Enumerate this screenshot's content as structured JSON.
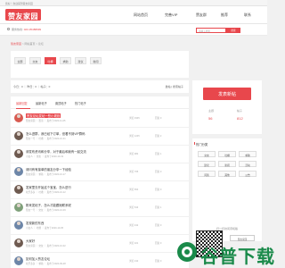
{
  "topbar": {
    "text": "您好！欢迎来到赞友家园"
  },
  "header": {
    "logo": "赞友家园",
    "nav": [
      "网站首页",
      "完善VIP",
      "赞友群",
      "推荐",
      "联系"
    ]
  },
  "location": {
    "label": "服务热线:",
    "phone": "023-35488999"
  },
  "search": {
    "placeholder": "请输入搜索",
    "button": "搜索"
  },
  "breadcrumb": {
    "home": "赞友家园",
    "items": [
      "网站首页",
      "论坛"
    ]
  },
  "categories": [
    {
      "label": "全部",
      "active": false
    },
    {
      "label": "交友",
      "active": false
    },
    {
      "label": "吐槽",
      "active": true
    },
    {
      "label": "求助",
      "active": false
    },
    {
      "label": "建议",
      "active": false
    },
    {
      "label": "新闻",
      "active": false
    }
  ],
  "stats": {
    "left": "今日：0 ｜ 昨日：0 ｜ 帖子：0",
    "right": "发帖 | 搜索帖子"
  },
  "tabs": [
    {
      "label": "最新回复",
      "active": true
    },
    {
      "label": "最新帖子",
      "active": false
    },
    {
      "label": "置顶帖子",
      "active": false
    },
    {
      "label": "热门帖子",
      "active": false
    }
  ],
  "posts": [
    {
      "title": "赞友论坛发帖一些小规则",
      "meta": "赞友家园 ｜ 置顶 ｜ 发布于2020-11-05",
      "views": "浏览 3345",
      "replies": "回复 0",
      "avatar": "red",
      "highlight": true
    },
    {
      "title": "怎么进群，我已经下订单，但看不到VIP群码",
      "meta": "赞友一号 ｜ 吐槽 ｜ 发布于2020-10-21",
      "views": "浏览 1245",
      "replies": "回复 2",
      "avatar": "dark",
      "highlight": false
    },
    {
      "title": "请发布资讯和分享，对于最后和我有一起交流",
      "meta": "小女人 ｜ 交友 ｜ 发布于2020-10-19",
      "views": "浏览 982",
      "replies": "回复 1",
      "avatar": "dark",
      "highlight": false
    },
    {
      "title": "请问有有接单的朋友分享一下经验",
      "meta": "赞友家园 ｜ 求助 ｜ 发布于2020-10-17",
      "views": "浏览 765",
      "replies": "回复 0",
      "avatar": "blue",
      "highlight": false
    },
    {
      "title": "发家里去开始这个宝宝，怎么进行",
      "meta": "欢乐多多 ｜ 吐槽 ｜ 发布于2020-10-12",
      "views": "浏览 654",
      "replies": "回复 0",
      "avatar": "dark",
      "highlight": false
    },
    {
      "title": "刚来发帖子，怎么才能跟她联系呢",
      "meta": "赞友一号 ｜ 交友 ｜ 发布于2020-10-09",
      "views": "浏览 543",
      "replies": "回复 1",
      "avatar": "green",
      "highlight": false
    },
    {
      "title": "发现新的东西",
      "meta": "小女人 ｜ 吐槽 ｜ 发布于2020-10-05",
      "views": "浏览 432",
      "replies": "回复 0",
      "avatar": "blue",
      "highlight": false
    },
    {
      "title": "大家好",
      "meta": "赞友家园 ｜ 交友 ｜ 发布于2020-10-02",
      "views": "浏览 321",
      "replies": "回复 0",
      "avatar": "dark",
      "highlight": false
    },
    {
      "title": "如何加入赞友论坛",
      "meta": "欢乐多多 ｜ 求助 ｜ 发布于2020-09-28",
      "views": "浏览 210",
      "replies": "回复 0",
      "avatar": "blue",
      "highlight": false
    }
  ],
  "sidebar": {
    "post_button": "发表新帖",
    "stat_labels": [
      "主题",
      "帖子"
    ],
    "stat_values": [
      "56",
      "812"
    ],
    "hot_title": "热门分类",
    "tags": [
      "交友",
      "吐槽",
      "求助",
      "建议",
      "新闻",
      "活动",
      "问答",
      "其他",
      "公告"
    ],
    "qr_title": "扫一扫访问手机版",
    "mini_label": "赞友家园"
  },
  "watermark": {
    "text": "谷普下载"
  },
  "colors": {
    "accent": "#e8474c",
    "watermark": "#1a8a4a"
  }
}
